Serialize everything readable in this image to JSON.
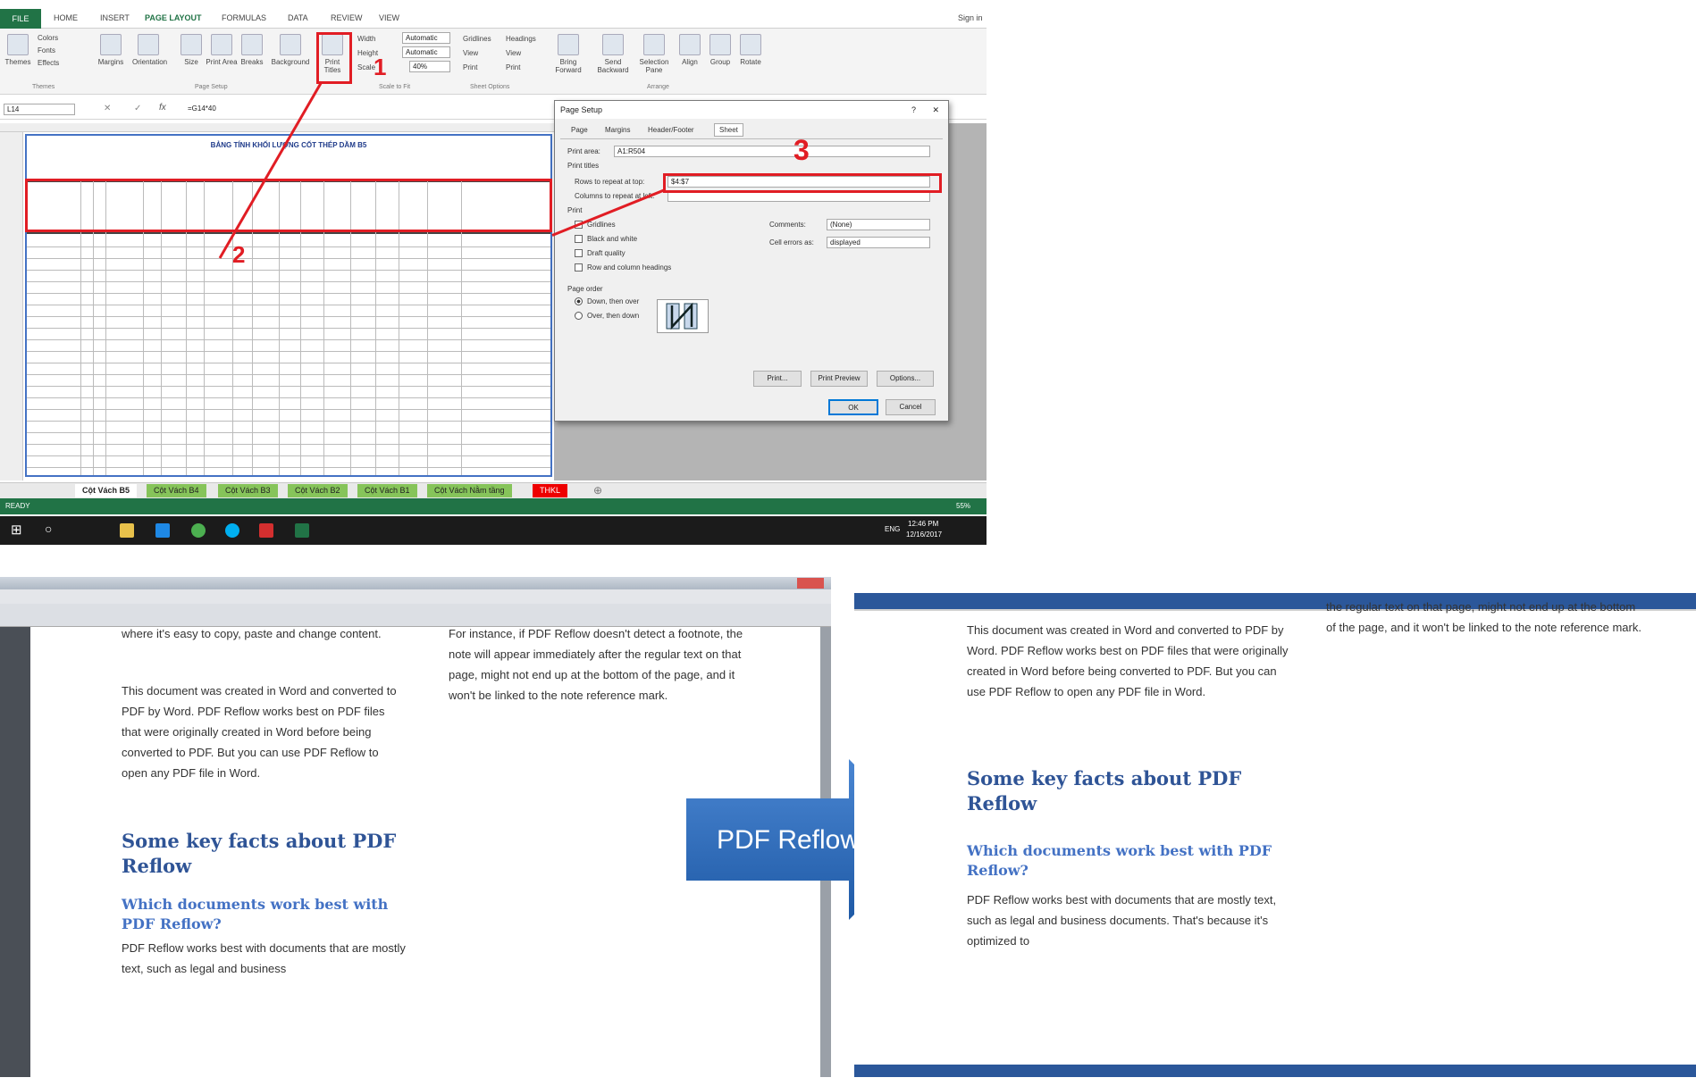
{
  "excel": {
    "file_tab": "FILE",
    "tabs": [
      "HOME",
      "INSERT",
      "PAGE LAYOUT",
      "FORMULAS",
      "DATA",
      "REVIEW",
      "VIEW"
    ],
    "sign_in": "Sign in",
    "buttons": [
      "Themes",
      "Margins",
      "Orientation",
      "Size",
      "Print Area",
      "Breaks",
      "Background",
      "Print Titles"
    ],
    "groups": [
      "Themes",
      "Page Setup",
      "Scale to Fit",
      "Sheet Options",
      "Arrange"
    ],
    "theme_items": [
      "Colors",
      "Fonts",
      "Effects"
    ],
    "scale_labels": [
      "Width",
      "Height",
      "Scale"
    ],
    "scale_values": [
      "Automatic",
      "Automatic",
      "40%"
    ],
    "sheet_option_heads": [
      "Gridlines",
      "Headings"
    ],
    "sheet_option_items": [
      "View",
      "Print"
    ],
    "arrange_buttons": [
      "Bring Forward",
      "Send Backward",
      "Selection Pane",
      "Align",
      "Group",
      "Rotate"
    ],
    "name_box": "L14",
    "formula": "=G14*40",
    "sheet_title": "BẢNG TÍNH KHỐI LƯỢNG CỐT THÉP DẦM B5",
    "sheet_tabs": [
      {
        "label": "Cột Vách B5",
        "color": "#ffffff"
      },
      {
        "label": "Cột Vách B4",
        "color": "#92d050"
      },
      {
        "label": "Cột Vách B3",
        "color": "#92d050"
      },
      {
        "label": "Cột Vách B2",
        "color": "#92d050"
      },
      {
        "label": "Cột Vách B1",
        "color": "#92d050"
      },
      {
        "label": "Cột Vách Nằm tầng",
        "color": "#92d050"
      },
      {
        "label": "THKL",
        "color": "#ff0000"
      }
    ],
    "status_text": "READY",
    "zoom": "55%",
    "clock_time": "12:46 PM",
    "clock_date": "12/16/2017",
    "language": "ENG"
  },
  "dialog": {
    "title": "Page Setup",
    "help": "?",
    "close": "✕",
    "tabs": [
      "Page",
      "Margins",
      "Header/Footer",
      "Sheet"
    ],
    "print_area_label": "Print area:",
    "print_area_value": "A1:R504",
    "print_titles_label": "Print titles",
    "rows_repeat_label": "Rows to repeat at top:",
    "rows_repeat_value": "$4:$7",
    "cols_repeat_label": "Columns to repeat at left:",
    "print_label": "Print",
    "print_checks": [
      "Gridlines",
      "Black and white",
      "Draft quality",
      "Row and column headings"
    ],
    "comments_label": "Comments:",
    "comments_value": "(None)",
    "errors_label": "Cell errors as:",
    "errors_value": "displayed",
    "page_order_label": "Page order",
    "order_options": [
      "Down, then over",
      "Over, then down"
    ],
    "print_button": "Print...",
    "preview_button": "Print Preview",
    "options_button": "Options...",
    "ok_button": "OK",
    "cancel_button": "Cancel"
  },
  "annotations": [
    "1",
    "2",
    "3"
  ],
  "arrow_label": "PDF Reflow",
  "pdf_doc": {
    "col1_top": "where it's easy to copy, paste and change content.",
    "col1_p1": "This document was created in Word and converted to PDF by Word. PDF Reflow works best on PDF files that were originally created in Word before being converted to PDF. But you can use PDF Reflow to open any PDF file in Word.",
    "col2_p1": "For instance, if PDF Reflow doesn't detect a footnote, the note will appear immediately after the regular text on that page, might not end up at the bottom of the page, and it won't be linked to the note reference mark.",
    "h1": "Some key facts about PDF Reflow",
    "h2": "Which documents work best with PDF Reflow?",
    "p2": "PDF Reflow works best with documents that are mostly text, such as legal and business"
  },
  "word_doc": {
    "top_right": "the regular text on that page, might not end up at the bottom of the page, and it won't be linked to the note reference mark.",
    "p1": "This document was created in Word and converted to PDF by Word. PDF Reflow works best on PDF files that were originally created in Word before being converted to PDF. But you can use PDF Reflow to open any PDF file in Word.",
    "h1": "Some key facts about PDF Reflow",
    "h2": "Which documents work best with PDF Reflow?",
    "p2": "PDF Reflow works best with documents that are mostly text, such as legal and business documents. That's because it's optimized to"
  }
}
